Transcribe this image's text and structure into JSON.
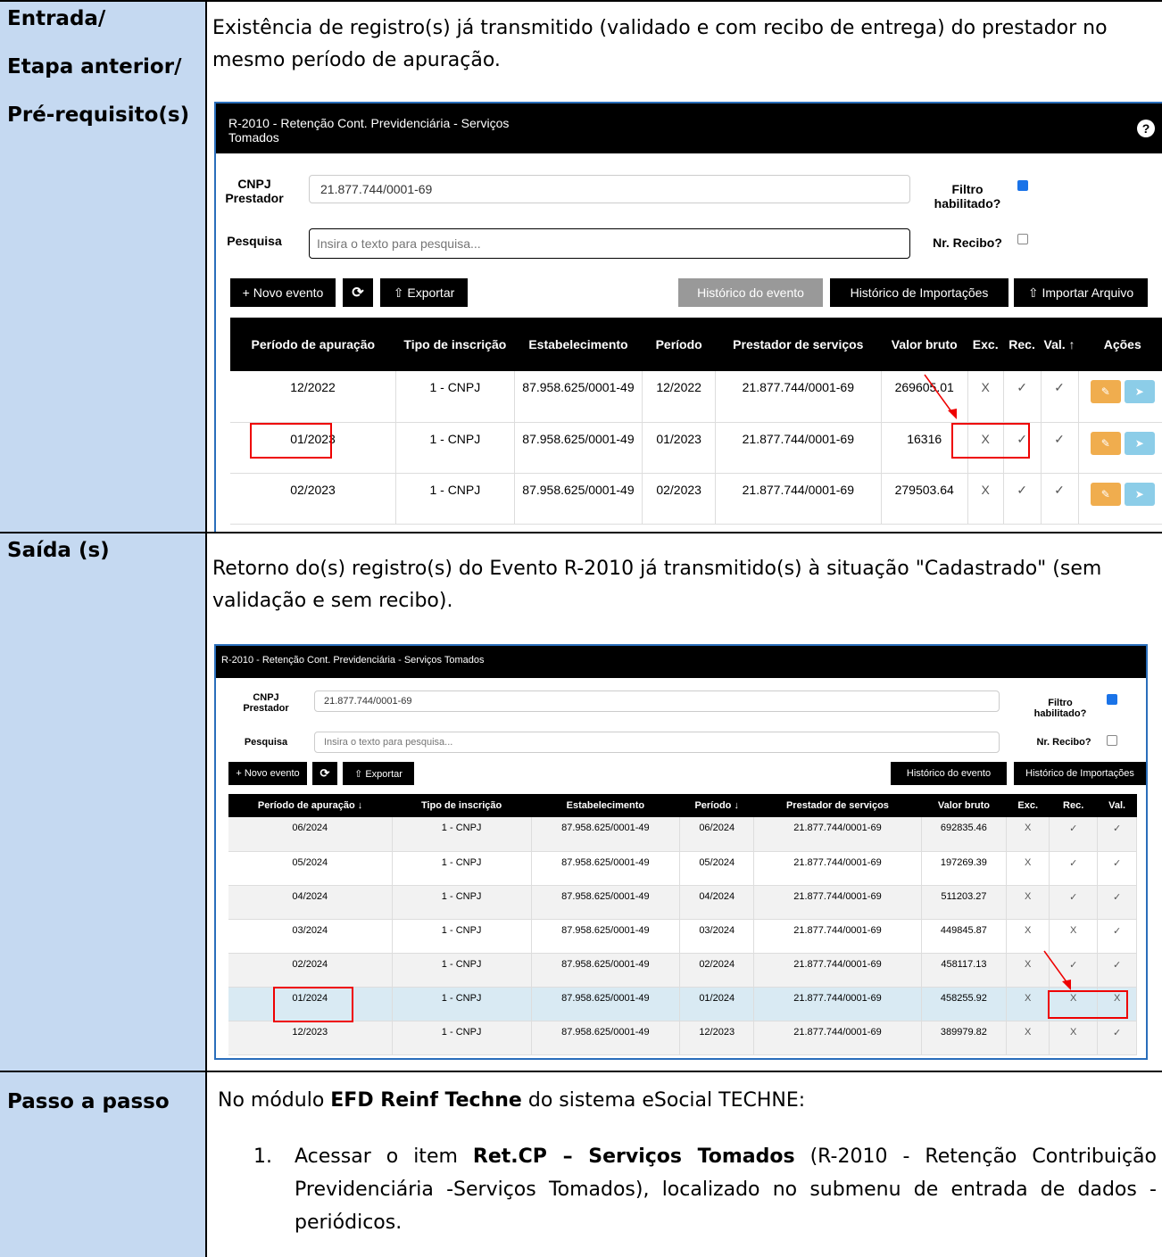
{
  "rows": {
    "entrada": {
      "label_lines": [
        "Entrada/",
        "Etapa anterior/",
        "Pré-requisito(s)"
      ],
      "text": "Existência de registro(s) já transmitido (validado e com recibo de entrega) do prestador no mesmo período de apuração."
    },
    "saida": {
      "label": "Saída (s)",
      "text": "Retorno do(s) registro(s) do Evento R-2010 já transmitido(s) à situação \"Cadastrado\" (sem validação e sem recibo)."
    },
    "passo": {
      "label": "Passo a passo",
      "intro_pre": "No módulo ",
      "intro_bold": "EFD Reinf Techne",
      "intro_post": " do sistema eSocial TECHNE:",
      "step_num": "1.",
      "step_pre": "Acessar o item ",
      "step_bold": "Ret.CP – Serviços Tomados",
      "step_post": " (R-2010 - Retenção Contribuição Previdenciária -Serviços Tomados), localizado no submenu de entrada de dados - periódicos."
    }
  },
  "shot1": {
    "title": "R-2010 - Retenção Cont. Previdenciária - Serviços Tomados",
    "help": "?",
    "cnpj_label": "CNPJ Prestador",
    "cnpj_value": "21.877.744/0001-69",
    "pesquisa_label": "Pesquisa",
    "pesquisa_placeholder": "Insira o texto para pesquisa...",
    "filtro_label": "Filtro habilitado?",
    "recibo_label": "Nr. Recibo?",
    "btn_novo": "+ Novo evento",
    "btn_refresh": "⟳",
    "btn_exportar": "⇧ Exportar",
    "btn_historico": "Histórico do evento",
    "btn_import_hist": "Histórico de Importações",
    "btn_importar": "⇧ Importar Arquivo",
    "headers": [
      "Período de apuração",
      "Tipo de inscrição",
      "Estabelecimento",
      "Período",
      "Prestador de serviços",
      "Valor bruto",
      "Exc.",
      "Rec.",
      "Val. ↑",
      "Ações"
    ],
    "rows": [
      [
        "12/2022",
        "1 - CNPJ",
        "87.958.625/0001-49",
        "12/2022",
        "21.877.744/0001-69",
        "269605.01",
        "X",
        "✓",
        "✓"
      ],
      [
        "01/2023",
        "1 - CNPJ",
        "87.958.625/0001-49",
        "01/2023",
        "21.877.744/0001-69",
        "16316",
        "X",
        "✓",
        "✓"
      ],
      [
        "02/2023",
        "1 - CNPJ",
        "87.958.625/0001-49",
        "02/2023",
        "21.877.744/0001-69",
        "279503.64",
        "X",
        "✓",
        "✓"
      ]
    ]
  },
  "shot2": {
    "title": "R-2010 - Retenção Cont. Previdenciária - Serviços Tomados",
    "cnpj_label": "CNPJ Prestador",
    "cnpj_value": "21.877.744/0001-69",
    "pesquisa_label": "Pesquisa",
    "pesquisa_placeholder": "Insira o texto para pesquisa...",
    "filtro_label": "Filtro habilitado?",
    "recibo_label": "Nr. Recibo?",
    "btn_novo": "+ Novo evento",
    "btn_refresh": "⟳",
    "btn_exportar": "⇧ Exportar",
    "btn_historico": "Histórico do evento",
    "btn_import_hist": "Histórico de Importações",
    "headers": [
      "Período de apuração ↓",
      "Tipo de inscrição",
      "Estabelecimento",
      "Período ↓",
      "Prestador de serviços",
      "Valor bruto",
      "Exc.",
      "Rec.",
      "Val."
    ],
    "rows": [
      [
        "06/2024",
        "1 - CNPJ",
        "87.958.625/0001-49",
        "06/2024",
        "21.877.744/0001-69",
        "692835.46",
        "X",
        "✓",
        "✓"
      ],
      [
        "05/2024",
        "1 - CNPJ",
        "87.958.625/0001-49",
        "05/2024",
        "21.877.744/0001-69",
        "197269.39",
        "X",
        "✓",
        "✓"
      ],
      [
        "04/2024",
        "1 - CNPJ",
        "87.958.625/0001-49",
        "04/2024",
        "21.877.744/0001-69",
        "511203.27",
        "X",
        "✓",
        "✓"
      ],
      [
        "03/2024",
        "1 - CNPJ",
        "87.958.625/0001-49",
        "03/2024",
        "21.877.744/0001-69",
        "449845.87",
        "X",
        "X",
        "✓"
      ],
      [
        "02/2024",
        "1 - CNPJ",
        "87.958.625/0001-49",
        "02/2024",
        "21.877.744/0001-69",
        "458117.13",
        "X",
        "✓",
        "✓"
      ],
      [
        "01/2024",
        "1 - CNPJ",
        "87.958.625/0001-49",
        "01/2024",
        "21.877.744/0001-69",
        "458255.92",
        "X",
        "X",
        "X"
      ],
      [
        "12/2023",
        "1 - CNPJ",
        "87.958.625/0001-49",
        "12/2023",
        "21.877.744/0001-69",
        "389979.82",
        "X",
        "X",
        "✓"
      ]
    ]
  },
  "colors": {
    "label_bg": "#c5d9f1",
    "highlight_row": "#d9eaf3",
    "red": "#e00000"
  }
}
